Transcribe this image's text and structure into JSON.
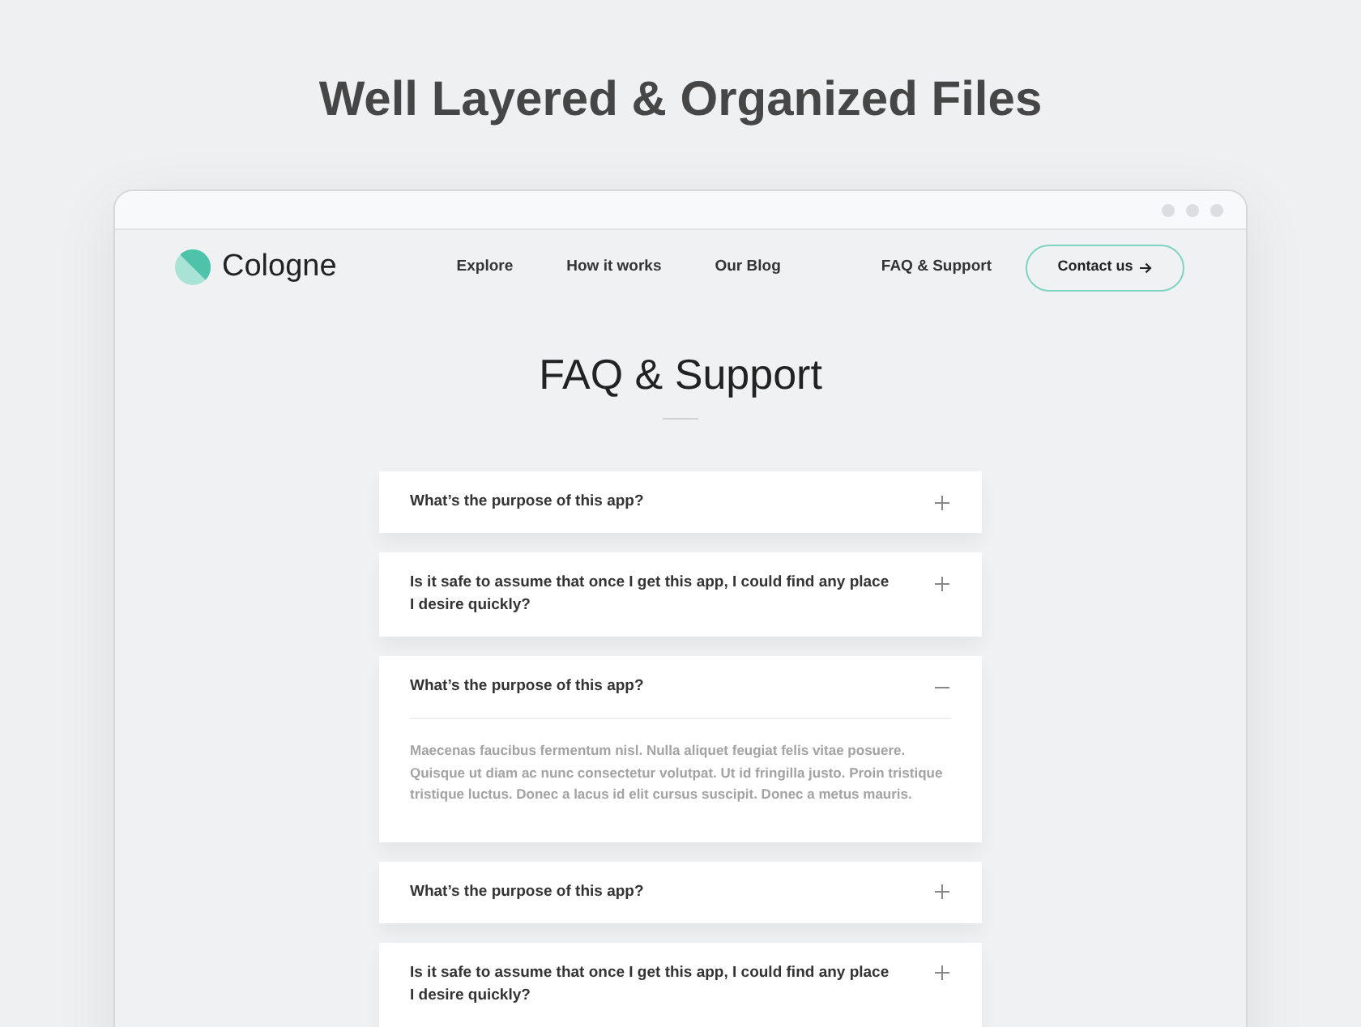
{
  "heading": "Well Layered & Organized Files",
  "site": {
    "brand": "Cologne",
    "nav": [
      "Explore",
      "How it works",
      "Our Blog"
    ],
    "support_link": "FAQ & Support",
    "contact_button": "Contact us"
  },
  "page_title": "FAQ & Support",
  "faqs": [
    {
      "question": "What’s the purpose of this app?",
      "expanded": false
    },
    {
      "question": "Is it safe to assume that once I get this app, I could find any place I desire quickly?",
      "expanded": false
    },
    {
      "question": "What’s the purpose of this app?",
      "expanded": true,
      "answer": "Maecenas faucibus fermentum nisl. Nulla aliquet feugiat felis vitae posuere. Quisque ut diam ac nunc consectetur volutpat. Ut id fringilla justo. Proin tristique tristique luctus. Donec a lacus id elit cursus suscipit. Donec a metus mauris."
    },
    {
      "question": "What’s the purpose of this app?",
      "expanded": false
    },
    {
      "question": "Is it safe to assume that once I get this app, I could find any place I desire quickly?",
      "expanded": false
    }
  ]
}
